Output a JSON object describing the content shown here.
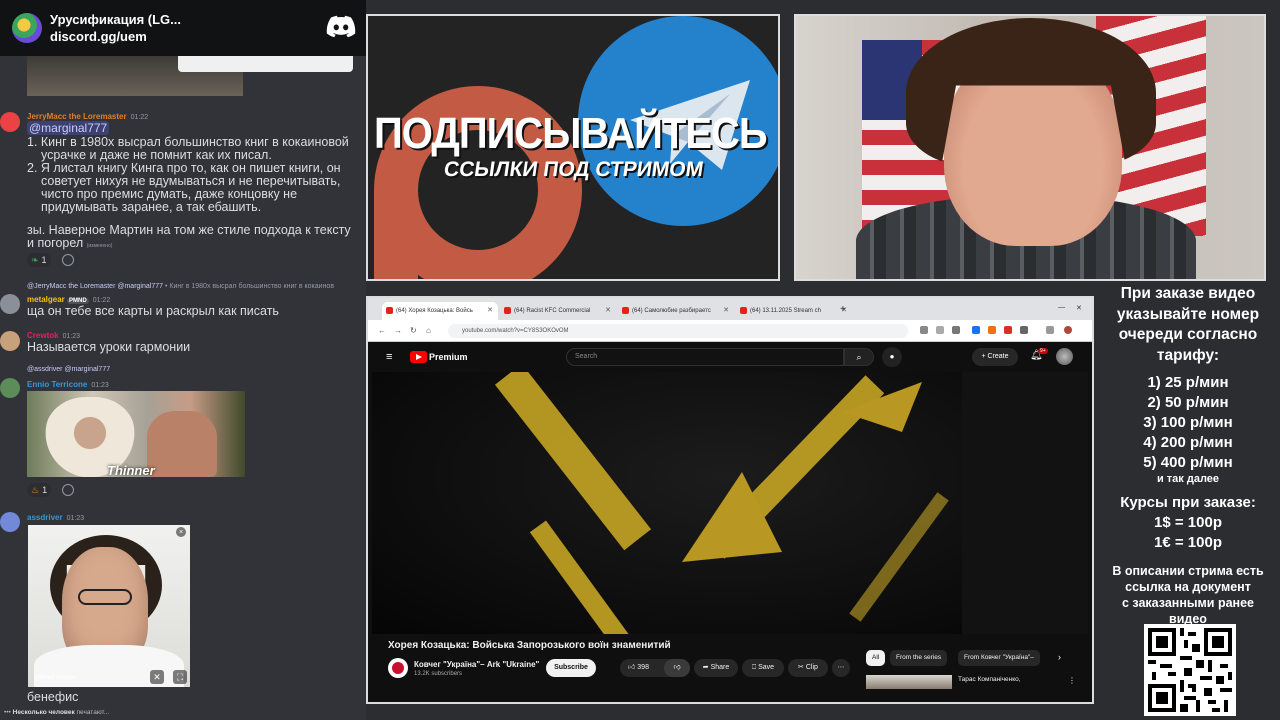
{
  "discord": {
    "server_name": "Урусификация (LG...",
    "server_invite": "discord.gg/uem",
    "messages": [
      {
        "author": "JerryMacc the Loremaster",
        "time": "01:22",
        "mention": "@marginal777",
        "list": [
          "1. Кинг в 1980х высрал большинство книг в кокаиновой усрачке и даже не помнит как их писал.",
          "2. Я листал книгу Кинга про то, как он пишет книги, он советует нихуя не вдумываться и не перечитывать, чисто про премис думать, даже концовку не придумывать заранее, а так ебашить."
        ],
        "text": "зы. Наверное Мартин на том же стиле подхода к тексту и погорел",
        "edited": "(изменено)",
        "reaction_count": "1"
      },
      {
        "author": "metalgear",
        "tag": "PMND",
        "time": "01:22",
        "reply_author": "@JerryMacc the Loremaster",
        "reply_mention": "@marginal777",
        "reply_text": "• Кинг в 1980х высрал большинство книг в кокаинов",
        "text": "ща он тебе все карты и раскрыл как писать"
      },
      {
        "author": "Crewtok",
        "time": "01:23",
        "text": "Называется уроки гармонии"
      },
      {
        "author": "Ennio Terricone",
        "time": "01:23",
        "reply_author": "@assdriver",
        "reply_mention": "@marginal777",
        "gif_caption": "Thinner",
        "reaction_count": "1"
      },
      {
        "author": "assdriver",
        "time": "01:23",
        "video_user": "Mikhail Svetov",
        "text": "бенефис"
      }
    ],
    "typing_user": "Несколько человек",
    "typing_text": "печатают..."
  },
  "banner": {
    "line1": "ПОДПИСЫВАЙТЕСЬ",
    "line2": "ССЫЛКИ ПОД СТРИМОМ"
  },
  "browser": {
    "tabs": [
      "(64) Хорея Козацька: Войсь",
      "(64) Racist KFC Commercial",
      "(64) Самолюбие разбираетс",
      "(64) 13.11.2025 Stream ch"
    ],
    "url": "youtube.com/watch?v=CY8S3OKOvOM"
  },
  "youtube": {
    "brand": "Premium",
    "search_placeholder": "Search",
    "create_label": "+ Create",
    "notif_count": "9+",
    "video_title": "Хорея Козацька: Войська Запорозького воїн знаменитий",
    "channel_name": "Ковчег \"Україна\"– Ark \"Ukraine\"",
    "subscribers": "13.2K subscribers",
    "subscribe_label": "Subscribe",
    "likes": "398",
    "share_label": "Share",
    "save_label": "Save",
    "clip_label": "Clip",
    "chips": [
      "All",
      "From the series",
      "From Ковчег \"Україна\"–"
    ],
    "rec_title": "Тарас Компаніченко,"
  },
  "right_panel": {
    "heading": [
      "При заказе видео",
      "указывайте номер",
      "очереди согласно",
      "тарифу:"
    ],
    "tariffs": [
      "1) 25 р/мин",
      "2) 50 р/мин",
      "3) 100 р/мин",
      "4) 200 р/мин",
      "5) 400 р/мин"
    ],
    "etc": "и так далее",
    "rates_heading": "Курсы при заказе:",
    "rates": [
      "1$ = 100р",
      "1€ = 100р"
    ],
    "note": [
      "В описании стрима есть",
      "ссылка на документ",
      "с заказанными ранее",
      "видео"
    ]
  },
  "colors": {
    "discord_bg": "#313338",
    "discord_dark": "#111214",
    "mention": "#c9cdfb",
    "youtube_red": "#ff0000",
    "telegram_blue": "#2481cc",
    "patreon_red": "#c35a43",
    "video_yellow": "#c5a425"
  }
}
